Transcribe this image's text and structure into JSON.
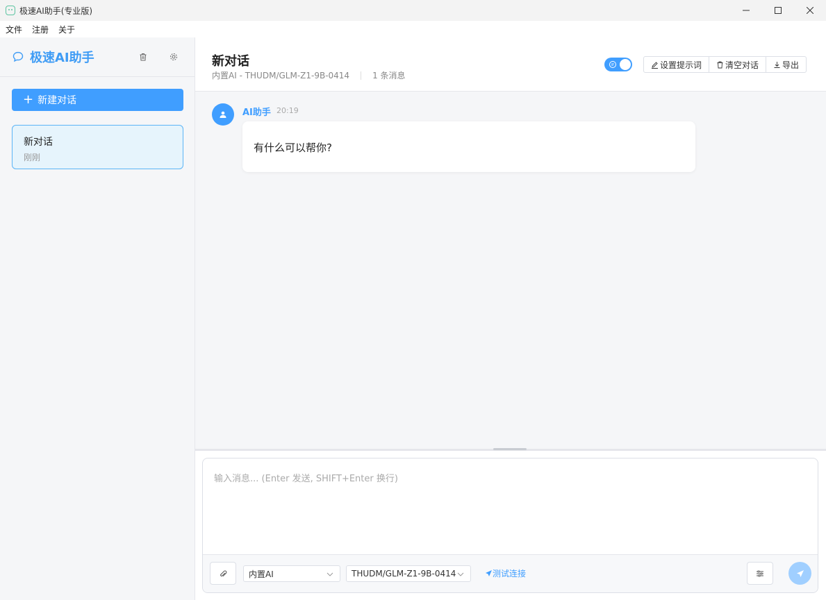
{
  "window": {
    "title": "极速AI助手(专业版)",
    "minimize_icon": "minimize-icon",
    "maximize_icon": "maximize-icon",
    "close_icon": "close-icon"
  },
  "menu": {
    "items": [
      "文件",
      "注册",
      "关于"
    ]
  },
  "sidebar": {
    "title": "极速AI助手",
    "new_chat_label": "新建对话",
    "conversations": [
      {
        "title": "新对话",
        "time": "刚刚"
      }
    ]
  },
  "header": {
    "title": "新对话",
    "model_info": "内置AI - THUDM/GLM-Z1-9B-0414",
    "message_count": "1 条消息",
    "toggle_on": true,
    "buttons": {
      "prompt": "设置提示词",
      "clear": "清空对话",
      "export": "导出"
    }
  },
  "messages": [
    {
      "author": "AI助手",
      "time": "20:19",
      "text": "有什么可以帮你?"
    }
  ],
  "composer": {
    "placeholder": "输入消息... (Enter 发送, SHIFT+Enter 换行)",
    "provider_value": "内置AI",
    "model_value": "THUDM/GLM-Z1-9B-0414",
    "test_label": "测试连接"
  },
  "colors": {
    "accent": "#409eff",
    "accent_light": "#a0cfff",
    "card_bg": "#e6f4fc"
  }
}
